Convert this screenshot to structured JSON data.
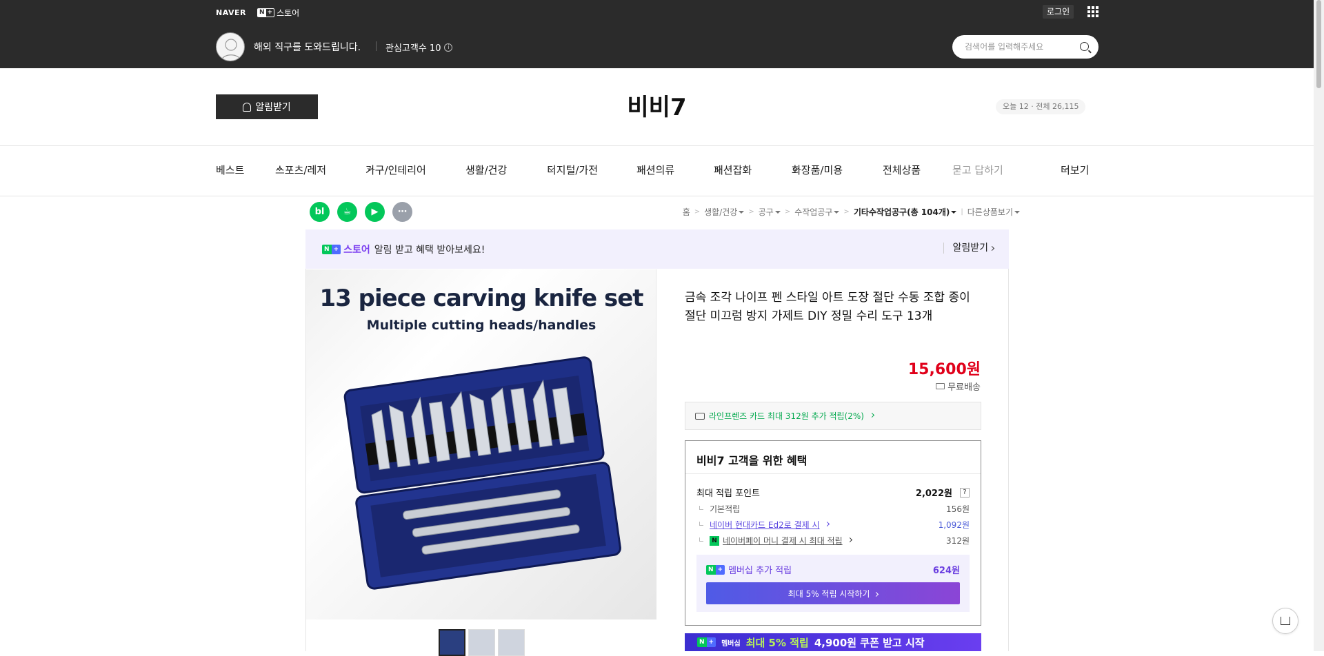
{
  "top": {
    "naver": "NAVER",
    "nplus_n": "N",
    "nplus_plus": "+",
    "store": "스토어",
    "login": "로그인",
    "tagline": "해외 직구를 도와드립니다.",
    "followers": "관심고객수 10",
    "search_placeholder": "검색어를 입력해주세요"
  },
  "header": {
    "alert_button": "알림받기",
    "store_name": "비비7",
    "visits_today": "오늘 12",
    "visits_total": "전체 26,115"
  },
  "nav": {
    "items": [
      "베스트",
      "스포츠/레저",
      "가구/인테리어",
      "생활/건강",
      "디지털/가전",
      "패션의류",
      "패션잡화",
      "화장품/미용",
      "전체상품",
      "묻고 답하기",
      "더보기"
    ]
  },
  "sns": [
    "bl",
    "☕",
    "▶",
    "⋯"
  ],
  "breadcrumb": {
    "items": [
      "홈",
      "생활/건강",
      "공구",
      "수작업공구"
    ],
    "current": "기타수작업공구(총 104개)",
    "other": "다른상품보기"
  },
  "banner": {
    "store": "스토어",
    "text": "알림 받고 혜택 받아보세요!",
    "action": "알림받기"
  },
  "product": {
    "image_title": "13 piece carving knife set",
    "image_subtitle": "Multiple cutting heads/handles",
    "title": "금속 조각 나이프 펜 스타일 아트 도장 절단 수동 조합 종이 절단 미끄럼 방지 가제트 DIY 정밀 수리 도구 13개",
    "price": "15,600원",
    "shipping": "무료배송",
    "card_promo": "라인프렌즈 카드 최대 312원 추가 적립(2%)"
  },
  "benefit": {
    "title": "비비7 고객을 위한 혜택",
    "max_points_label": "최대 적립 포인트",
    "max_points_value": "2,022원",
    "help": "?",
    "basic_label": "기본적립",
    "basic_value": "156원",
    "card_label": "네이버 현대카드 Ed2로 결제 시",
    "card_value": "1,092원",
    "pay_label": "네이버페이 머니 결제 시 최대 적립",
    "pay_value": "312원",
    "membership_label": "멤버십 추가 적립",
    "membership_value": "624원",
    "membership_button": "최대 5% 적립 시작하기",
    "bottom_tag": "멤버십",
    "bottom_highlight": "최대 5% 적립",
    "bottom_text": "4,900원 쿠폰 받고 시작"
  },
  "colors": {
    "topbar": "#2b2b2b",
    "price": "#e0001a",
    "naver_green": "#03c75a",
    "membership_purple": "#7b3ef0"
  }
}
